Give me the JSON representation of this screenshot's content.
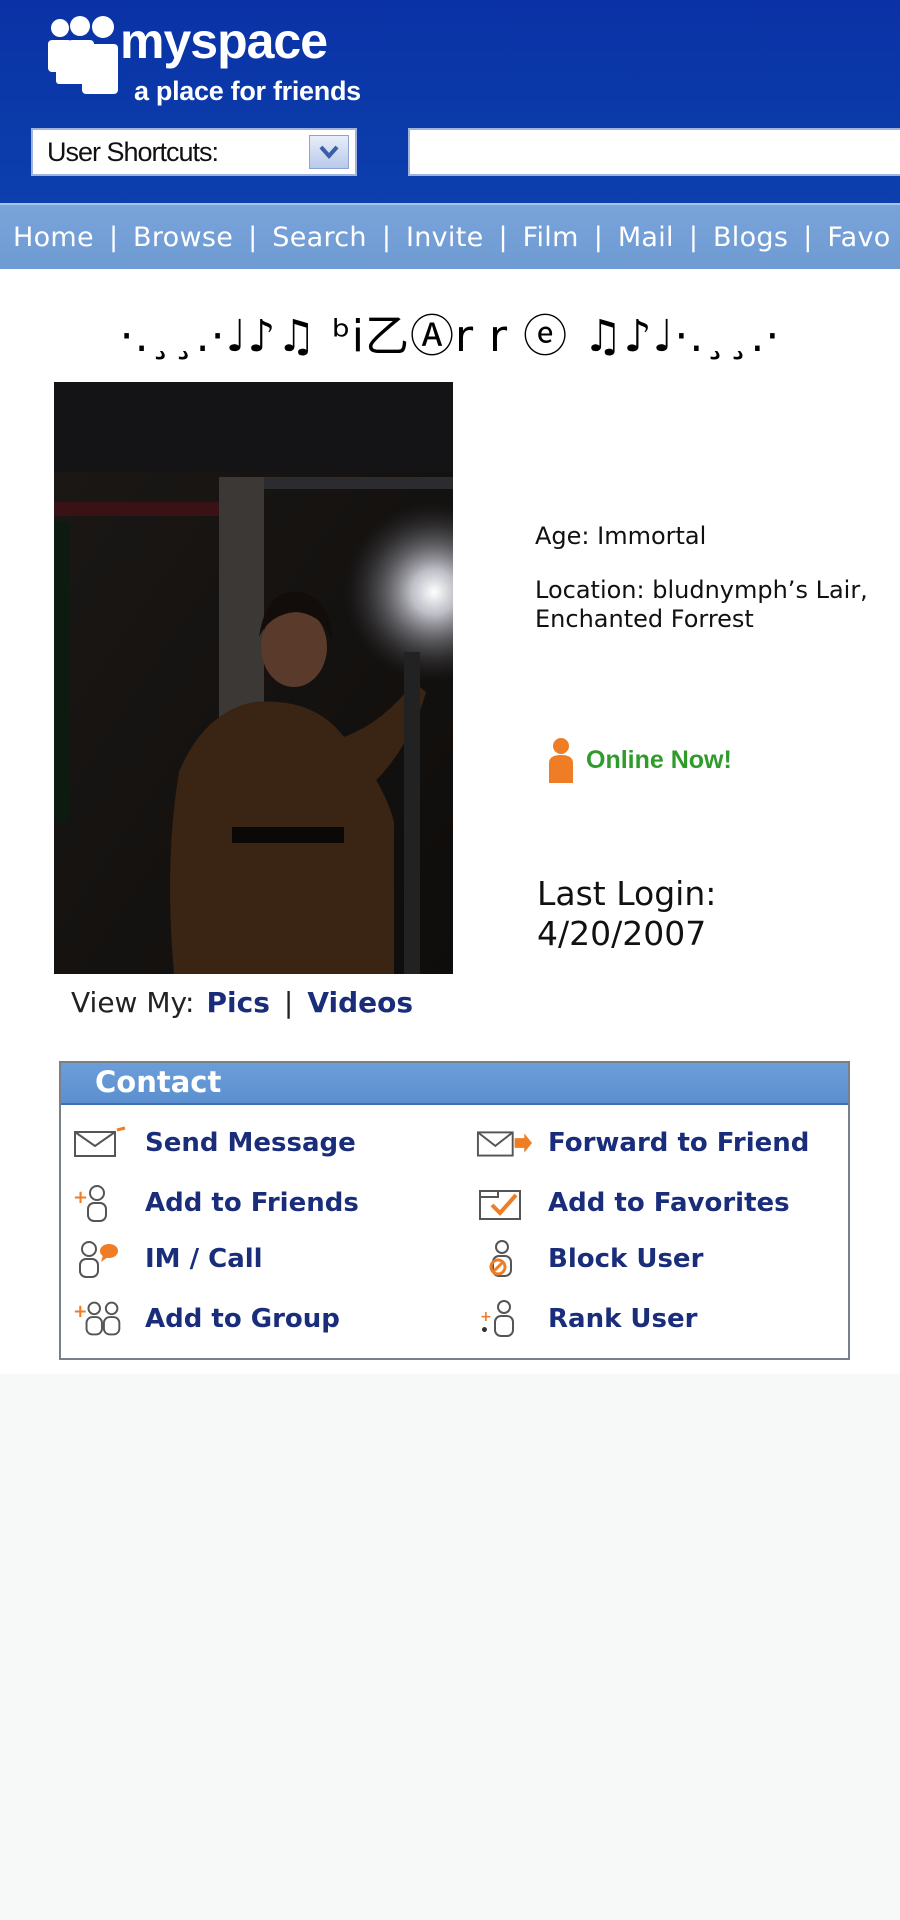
{
  "header": {
    "logo_name": "myspace",
    "logo_tagline": "a place for friends",
    "shortcuts_label": "User Shortcuts:",
    "search_value": ""
  },
  "nav": {
    "items": [
      "Home",
      "Browse",
      "Search",
      "Invite",
      "Film",
      "Mail",
      "Blogs",
      "Favo"
    ]
  },
  "profile": {
    "display_name": "·.¸¸.·♩♪♫ ᵇi乙Ⓐr r ⓔ ♫♪♩·.¸¸.·",
    "age": "Age: Immortal",
    "location": "Location: bludnymph’s Lair, Enchanted Forrest",
    "online_status": "Online Now!",
    "last_login_label": "Last Login:",
    "last_login_date": "4/20/2007",
    "view_my_label": "View My:",
    "view_my_links": [
      "Pics",
      "Videos"
    ]
  },
  "contact": {
    "title": "Contact",
    "left": [
      {
        "label": "Send Message",
        "icon": "envelope-icon"
      },
      {
        "label": "Add to Friends",
        "icon": "add-friend-icon"
      },
      {
        "label": "IM / Call",
        "icon": "im-call-icon"
      },
      {
        "label": "Add to Group",
        "icon": "add-group-icon"
      }
    ],
    "right": [
      {
        "label": "Forward to Friend",
        "icon": "forward-envelope-icon"
      },
      {
        "label": "Add to Favorites",
        "icon": "favorites-icon"
      },
      {
        "label": "Block User",
        "icon": "block-user-icon"
      },
      {
        "label": "Rank User",
        "icon": "rank-user-icon"
      }
    ]
  },
  "colors": {
    "header_blue": "#0b3aa9",
    "nav_blue": "#739fd6",
    "link_navy": "#1a2d7a",
    "online_green": "#2e9b2a",
    "online_orange": "#ee7d25"
  }
}
